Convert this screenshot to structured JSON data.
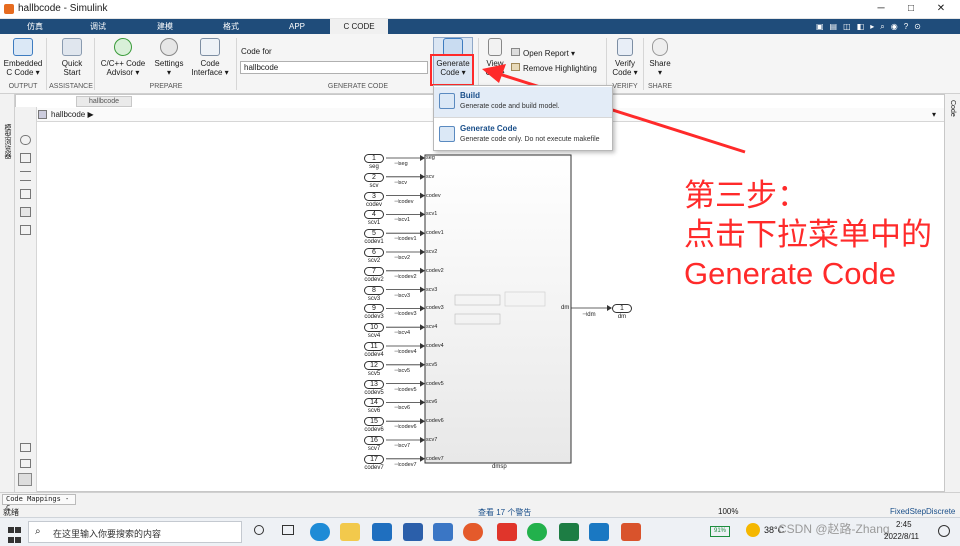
{
  "window": {
    "title": "hallbcode - Simulink"
  },
  "tabs": [
    "仿真",
    "调试",
    "建模",
    "格式",
    "APP",
    "C CODE"
  ],
  "toolstrip": {
    "buttons": {
      "embedded": "Embedded\nC Code ▾",
      "quick_start": "Quick\nStart",
      "advisor": "C/C++ Code\nAdvisor ▾",
      "settings": "Settings\n▾",
      "code_interface": "Code\nInterface ▾",
      "generate_code": "Generate\nCode ▾",
      "view_code": "View\nCode",
      "open_report": "Open Report",
      "remove_highlighting": "Remove Highlighting",
      "verify_code": "Verify\nCode ▾",
      "share": "Share\n▾"
    },
    "code_for_label": "Code for",
    "code_for_value": "hallbcode",
    "groups": {
      "output": "OUTPUT",
      "assistance": "ASSISTANCE",
      "prepare": "PREPARE",
      "generate": "GENERATE CODE",
      "verify": "VERIFY",
      "share": "SHARE"
    }
  },
  "dropdown": {
    "items": [
      {
        "title": "Build",
        "desc": "Generate code and build model."
      },
      {
        "title": "Generate Code",
        "desc": "Generate code only. Do not execute makefile"
      }
    ]
  },
  "model": {
    "tab": "hallbcode",
    "breadcrumb": "hallbcode ▶",
    "inputs": [
      {
        "num": "1",
        "name": "seg"
      },
      {
        "num": "2",
        "name": "scv"
      },
      {
        "num": "3",
        "name": "codev"
      },
      {
        "num": "4",
        "name": "scv1"
      },
      {
        "num": "5",
        "name": "codev1"
      },
      {
        "num": "6",
        "name": "scv2"
      },
      {
        "num": "7",
        "name": "codev2"
      },
      {
        "num": "8",
        "name": "scv3"
      },
      {
        "num": "9",
        "name": "codev3"
      },
      {
        "num": "10",
        "name": "scv4"
      },
      {
        "num": "11",
        "name": "codev4"
      },
      {
        "num": "12",
        "name": "scv5"
      },
      {
        "num": "13",
        "name": "codev5"
      },
      {
        "num": "14",
        "name": "scv6"
      },
      {
        "num": "15",
        "name": "codev6"
      },
      {
        "num": "16",
        "name": "scv7"
      },
      {
        "num": "17",
        "name": "codev7"
      }
    ],
    "block_name": "dmsp",
    "output_port": {
      "num": "1",
      "name": "dm",
      "signal": "dm"
    }
  },
  "annotation": {
    "text": "第三步：\n点击下拉菜单中的\nGenerate Code",
    "color": "#ff2a2a"
  },
  "sidebar_left_label": "模型浏览器",
  "sidebar_right_label": "Code",
  "statusbar": {
    "mapping_tab": "Code Mappings - C",
    "ready": "就绪",
    "warnings": "查看 17 个警告",
    "zoom": "100%",
    "solver": "FixedStepDiscrete"
  },
  "taskbar": {
    "search_placeholder": "在这里输入你要搜索的内容",
    "battery": "91%",
    "temperature": "38°C",
    "time": "2:45",
    "date": "2022/8/11",
    "watermark": "CSDN @赵路-Zhang"
  }
}
